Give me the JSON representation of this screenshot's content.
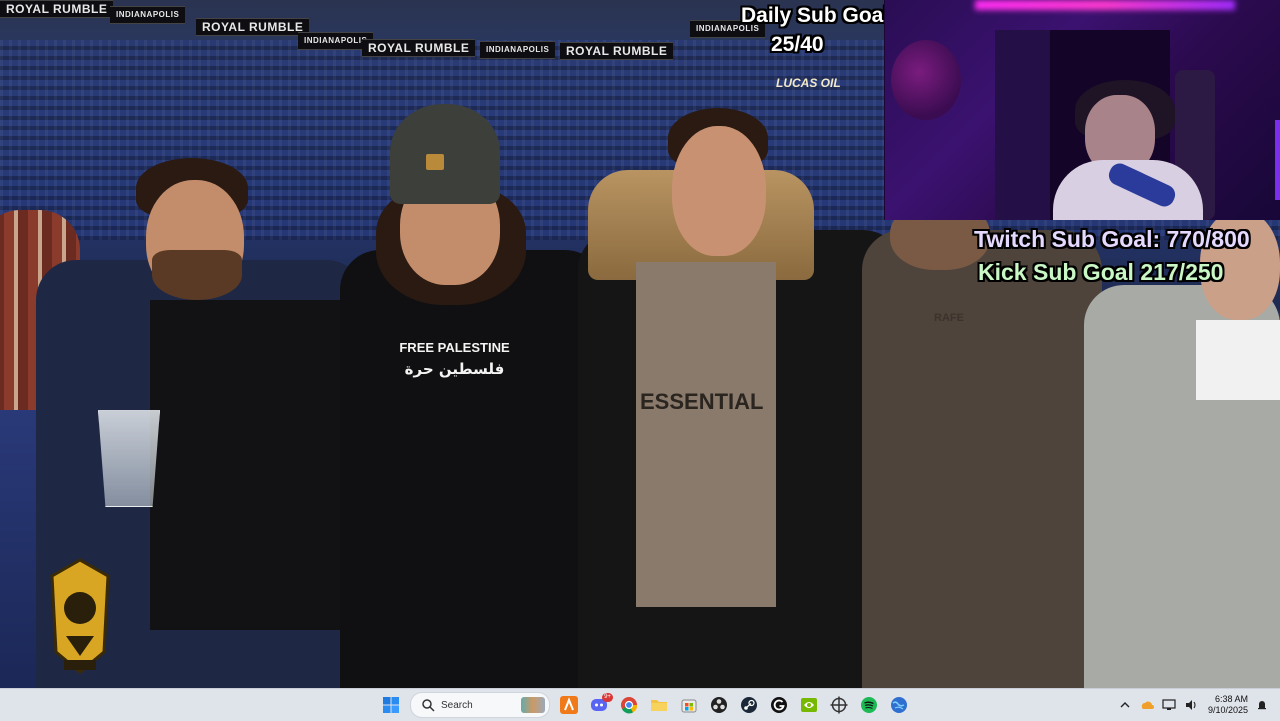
{
  "background": {
    "banners": [
      {
        "text": "ROYAL RUMBLE"
      },
      {
        "text": "INDIANAPOLIS"
      },
      {
        "text": "ROYAL RUMBLE"
      },
      {
        "text": "INDIANAPOLIS"
      },
      {
        "text": "ROYAL RUMBLE"
      },
      {
        "text": "INDIANAPOLIS"
      },
      {
        "text": "ROYAL RUMBLE"
      },
      {
        "text": "INDIANAPOLIS"
      }
    ],
    "sponsor": "LUCAS OIL",
    "shirt_print": {
      "line1": "FREE PALESTINE",
      "line2": "فلسطين حرة"
    },
    "shirt_print_2": "ESSENTIAL",
    "hoodie_print": "RAFE"
  },
  "overlay": {
    "daily_sub_goal_title": "Daily Sub Goal",
    "daily_sub_goal_count": "25/40",
    "twitch_sub_goal": "Twitch Sub Goal: 770/800",
    "kick_sub_goal": "Kick Sub Goal  217/250"
  },
  "taskbar": {
    "search_placeholder": "Search",
    "pinned": [
      {
        "name": "windows-start-icon"
      },
      {
        "name": "search-box"
      },
      {
        "name": "app-orange-a-icon"
      },
      {
        "name": "discord-icon",
        "badge": "9+"
      },
      {
        "name": "chrome-icon"
      },
      {
        "name": "file-explorer-icon"
      },
      {
        "name": "store-icon"
      },
      {
        "name": "obs-icon"
      },
      {
        "name": "steam-icon"
      },
      {
        "name": "logitech-g-icon"
      },
      {
        "name": "nvidia-icon"
      },
      {
        "name": "crosshair-app-icon"
      },
      {
        "name": "spotify-icon"
      },
      {
        "name": "globe-app-icon"
      }
    ],
    "clock_time": "6:38 AM",
    "clock_date": "9/10/2025"
  },
  "colors": {
    "taskbar_bg": "#dfe3ea",
    "twitch_goal": "#e6d9ff",
    "kick_goal": "#c9f7c5",
    "webcam_purple": "#3b1270"
  }
}
